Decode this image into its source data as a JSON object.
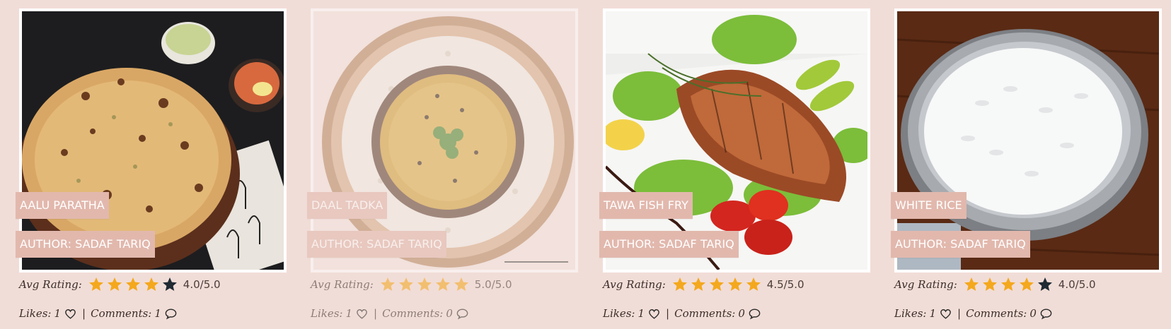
{
  "labels": {
    "avg_rating": "Avg Rating:",
    "likes": "Likes:",
    "comments": "Comments:",
    "separator": "|"
  },
  "colors": {
    "background": "#f1ddd7",
    "tag_background": "#e2b8ad",
    "star_filled": "#f4a81d",
    "star_empty": "#1f2a33"
  },
  "recipes": [
    {
      "title": "AALU PARATHA",
      "author": "AUTHOR: SADAF TARIQ",
      "stars": 4,
      "rating_text": "4.0/5.0",
      "likes": "1",
      "comments": "1",
      "image_icon": "aalu-paratha-photo"
    },
    {
      "title": "DAAL TADKA",
      "author": "AUTHOR: SADAF TARIQ",
      "stars": 5,
      "rating_text": "5.0/5.0",
      "likes": "1",
      "comments": "0",
      "image_icon": "daal-tadka-photo"
    },
    {
      "title": "TAWA FISH FRY",
      "author": "AUTHOR: SADAF TARIQ",
      "stars": 5,
      "rating_text": "4.5/5.0",
      "likes": "1",
      "comments": "0",
      "image_icon": "fish-fry-photo"
    },
    {
      "title": "WHITE RICE",
      "author": "AUTHOR: SADAF TARIQ",
      "stars": 4,
      "rating_text": "4.0/5.0",
      "likes": "1",
      "comments": "0",
      "image_icon": "white-rice-photo"
    }
  ]
}
